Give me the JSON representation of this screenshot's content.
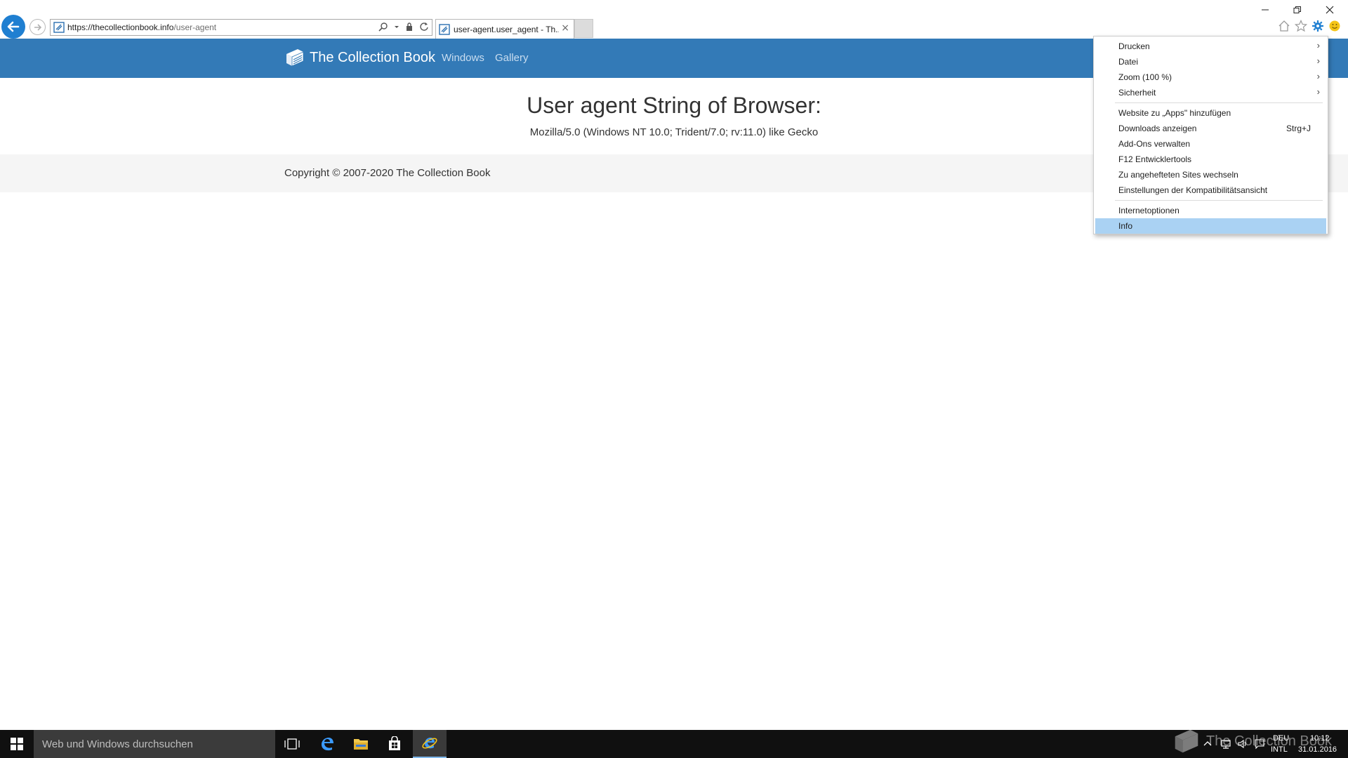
{
  "browser": {
    "url_host": "https://thecollectionbook.info",
    "url_path": "/user-agent",
    "tab_title": "user-agent.user_agent - Th...",
    "tab_close": "×"
  },
  "site": {
    "brand": "The Collection Book",
    "nav": [
      "Windows",
      "Gallery"
    ],
    "heading": "User agent String of Browser:",
    "user_agent": "Mozilla/5.0 (Windows NT 10.0; Trident/7.0; rv:11.0) like Gecko",
    "copyright": "Copyright © 2007-2020 The Collection Book"
  },
  "tools_menu": {
    "items": [
      {
        "label": "Drucken",
        "arrow": "›"
      },
      {
        "label": "Datei",
        "arrow": "›"
      },
      {
        "label": "Zoom (100 %)",
        "arrow": "›"
      },
      {
        "label": "Sicherheit",
        "arrow": "›"
      },
      {
        "label": "Website zu „Apps\" hinzufügen"
      },
      {
        "label": "Downloads anzeigen",
        "shortcut": "Strg+J"
      },
      {
        "label": "Add-Ons verwalten"
      },
      {
        "label": "F12 Entwicklertools"
      },
      {
        "label": "Zu angehefteten Sites wechseln"
      },
      {
        "label": "Einstellungen der Kompatibilitätsansicht"
      },
      {
        "label": "Internetoptionen"
      },
      {
        "label": "Info"
      }
    ],
    "highlight_color": "#aad2f3"
  },
  "taskbar": {
    "search_placeholder": "Web und Windows durchsuchen",
    "lang_top": "DEU",
    "lang_bottom": "INTL",
    "time": "10:12",
    "date": "31.01.2016",
    "watermark": "The Collection Book"
  },
  "colors": {
    "nav_bar": "#337ab7",
    "footer": "#f5f5f5",
    "taskbar": "#101010",
    "back_button": "#1f7fd1"
  }
}
